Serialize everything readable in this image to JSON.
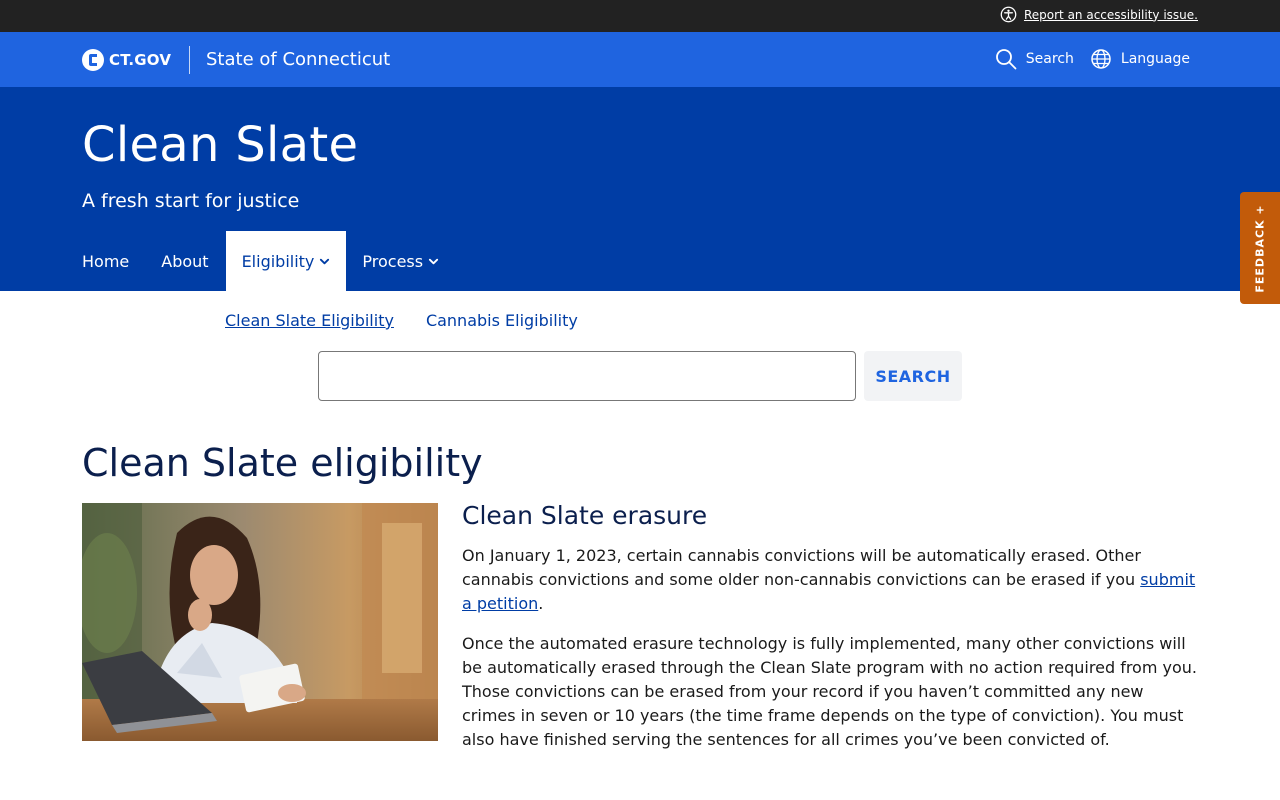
{
  "utility": {
    "accessibility_link": "Report an accessibility issue."
  },
  "gov_header": {
    "logo_text": "CT.GOV",
    "state_name": "State of Connecticut",
    "search_label": "Search",
    "language_label": "Language"
  },
  "hero": {
    "title": "Clean Slate",
    "subtitle": "A fresh start for justice"
  },
  "nav": {
    "items": [
      {
        "label": "Home"
      },
      {
        "label": "About"
      },
      {
        "label": "Eligibility"
      },
      {
        "label": "Process"
      }
    ]
  },
  "subnav": {
    "items": [
      {
        "label": "Clean Slate Eligibility"
      },
      {
        "label": "Cannabis Eligibility"
      }
    ]
  },
  "search": {
    "value": "",
    "button_label": "SEARCH"
  },
  "feedback": {
    "label": "FEEDBACK +"
  },
  "main": {
    "page_title": "Clean Slate eligibility",
    "section_title": "Clean Slate erasure",
    "para1_before": "On January 1, 2023, certain cannabis convictions will be automatically erased. Other cannabis convictions and some older non-cannabis convictions can be erased if you ",
    "para1_link": "submit a petition",
    "para1_after": ".",
    "para2": "Once the automated erasure technology is fully implemented, many other convictions will be automatically erased through the Clean Slate program with no action required from you. Those convictions can be erased from your record if you haven’t committed any new crimes in seven or 10 years (the time frame depends on the type of conviction). You must also have finished serving the sentences for all crimes you’ve been convicted of."
  },
  "colors": {
    "utility_bg": "#222222",
    "gov_bar_bg": "#1f64e0",
    "hero_bg": "#003da5",
    "feedback_bg": "#c25b0a",
    "link": "#003da5"
  }
}
